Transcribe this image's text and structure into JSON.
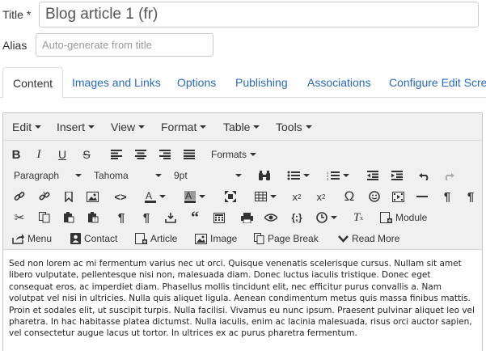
{
  "form": {
    "title_label": "Title",
    "title_required": " *",
    "title_value": "Blog article 1 (fr)",
    "alias_label": "Alias",
    "alias_placeholder": "Auto-generate from title"
  },
  "tabs": [
    {
      "label": "Content",
      "active": true
    },
    {
      "label": "Images and Links"
    },
    {
      "label": "Options"
    },
    {
      "label": "Publishing"
    },
    {
      "label": "Associations"
    },
    {
      "label": "Configure Edit Scree"
    }
  ],
  "editor": {
    "menus": [
      "Edit",
      "Insert",
      "View",
      "Format",
      "Table",
      "Tools"
    ],
    "formats_label": "Formats",
    "block_format": "Paragraph",
    "font_family": "Tahoma",
    "font_size": "9pt",
    "buttons": {
      "module": "Module",
      "menu": "Menu",
      "contact": "Contact",
      "article": "Article",
      "image": "Image",
      "page_break": "Page Break",
      "read_more": "Read More"
    },
    "content": "Sed non lorem ac mi fermentum varius nec ut orci. Quisque venenatis scelerisque cursus. Nullam sit amet libero vulputate, pellentesque nisi non, malesuada diam. Donec luctus iaculis tristique. Donec eget consequat eros, ac imperdiet diam. Phasellus mollis tincidunt elit, nec efficitur purus convallis a. Nam volutpat vel nisi in ultricies. Nulla quis aliquet ligula. Aenean condimentum metus quis massa finibus mattis. Proin et sodales elit, ut suscipit turpis. Nulla facilisi. Vivamus eu nunc ipsum. Praesent pulvinar aliquet leo vel pharetra. In hac habitasse platea dictumst. Nulla iaculis, enim ac lacinia malesuada, risus orci auctor sapien, vel consectetur augue lacus ut tortor. In ultrices ex ac purus pharetra fermentum."
  }
}
